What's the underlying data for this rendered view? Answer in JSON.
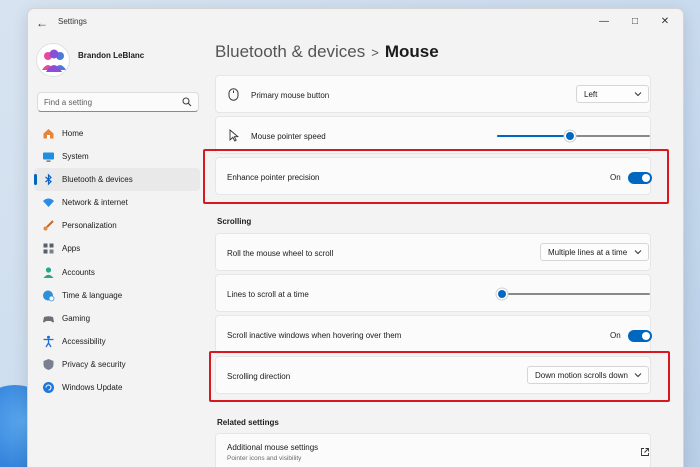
{
  "window": {
    "title": "Settings"
  },
  "user": {
    "name": "Brandon LeBlanc"
  },
  "search": {
    "placeholder": "Find a setting"
  },
  "sidebar": {
    "items": [
      {
        "label": "Home",
        "icon": "home-icon",
        "active": false
      },
      {
        "label": "System",
        "icon": "system-icon",
        "active": false
      },
      {
        "label": "Bluetooth & devices",
        "icon": "bluetooth-icon",
        "active": true
      },
      {
        "label": "Network & internet",
        "icon": "wifi-icon",
        "active": false
      },
      {
        "label": "Personalization",
        "icon": "brush-icon",
        "active": false
      },
      {
        "label": "Apps",
        "icon": "apps-icon",
        "active": false
      },
      {
        "label": "Accounts",
        "icon": "account-icon",
        "active": false
      },
      {
        "label": "Time & language",
        "icon": "globe-clock-icon",
        "active": false
      },
      {
        "label": "Gaming",
        "icon": "gamepad-icon",
        "active": false
      },
      {
        "label": "Accessibility",
        "icon": "accessibility-icon",
        "active": false
      },
      {
        "label": "Privacy & security",
        "icon": "shield-icon",
        "active": false
      },
      {
        "label": "Windows Update",
        "icon": "update-icon",
        "active": false
      }
    ]
  },
  "breadcrumb": {
    "parent": "Bluetooth & devices",
    "separator": ">",
    "current": "Mouse"
  },
  "settings": {
    "primary_button": {
      "label": "Primary mouse button",
      "value": "Left"
    },
    "pointer_speed": {
      "label": "Mouse pointer speed",
      "level": 0.48
    },
    "enhance_precision": {
      "label": "Enhance pointer precision",
      "state": "On"
    },
    "scrolling_title": "Scrolling",
    "roll_wheel": {
      "label": "Roll the mouse wheel to scroll",
      "value": "Multiple lines at a time"
    },
    "lines_to_scroll": {
      "label": "Lines to scroll at a time",
      "level": 0.03
    },
    "scroll_inactive": {
      "label": "Scroll inactive windows when hovering over them",
      "state": "On"
    },
    "scroll_direction": {
      "label": "Scrolling direction",
      "value": "Down motion scrolls down"
    },
    "related_title": "Related settings",
    "additional": {
      "label": "Additional mouse settings",
      "sublabel": "Pointer icons and visibility"
    }
  },
  "colors": {
    "accent": "#0067c0",
    "highlight": "#d9171e"
  }
}
